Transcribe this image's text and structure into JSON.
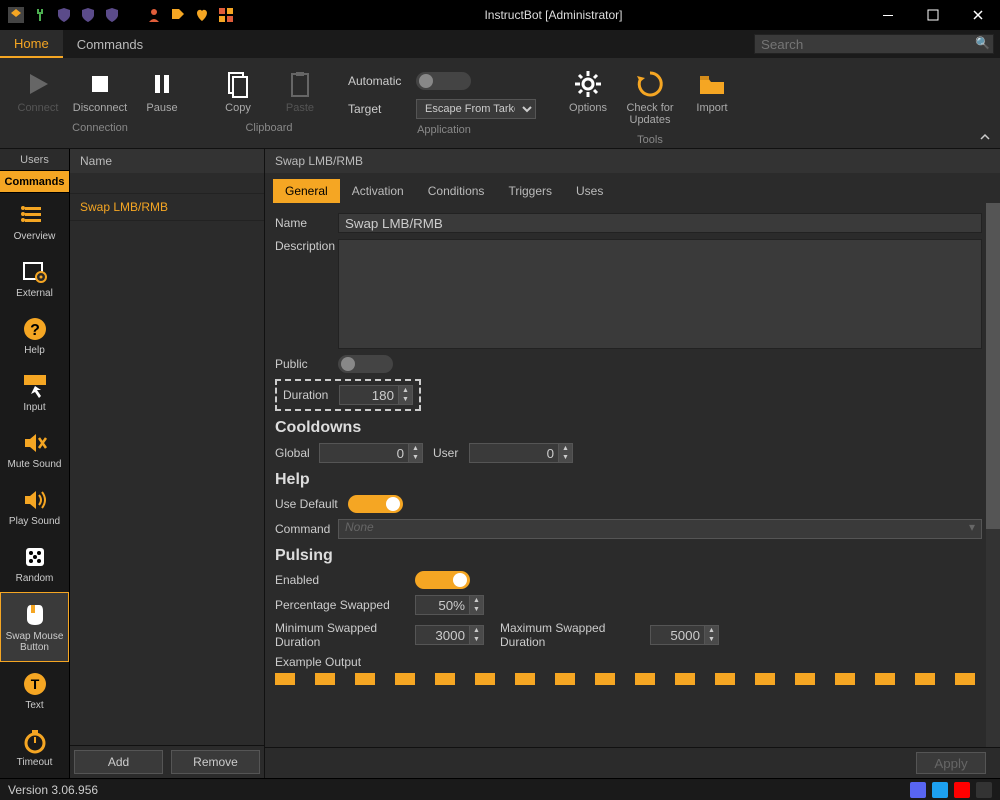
{
  "window": {
    "title": "InstructBot [Administrator]"
  },
  "tabs": {
    "home": "Home",
    "commands": "Commands"
  },
  "search": {
    "placeholder": "Search"
  },
  "ribbon": {
    "connect": "Connect",
    "disconnect": "Disconnect",
    "pause": "Pause",
    "copy": "Copy",
    "paste": "Paste",
    "automatic_label": "Automatic",
    "target_label": "Target",
    "target_value": "Escape From Tarkov",
    "options": "Options",
    "check_updates": "Check for\nUpdates",
    "import": "Import",
    "group_connection": "Connection",
    "group_clipboard": "Clipboard",
    "group_application": "Application",
    "group_tools": "Tools"
  },
  "left": {
    "users": "Users",
    "commands": "Commands",
    "overview": "Overview",
    "external": "External",
    "help": "Help",
    "input": "Input",
    "mute": "Mute Sound",
    "play": "Play Sound",
    "random": "Random",
    "swap": "Swap Mouse\nButton",
    "text": "Text",
    "timeout": "Timeout"
  },
  "mid": {
    "header": "Name",
    "item": "Swap LMB/RMB",
    "add": "Add",
    "remove": "Remove"
  },
  "detail": {
    "header": "Swap LMB/RMB",
    "tabs": {
      "general": "General",
      "activation": "Activation",
      "conditions": "Conditions",
      "triggers": "Triggers",
      "uses": "Uses"
    },
    "name_label": "Name",
    "name_value": "Swap LMB/RMB",
    "description_label": "Description",
    "description_value": "",
    "public_label": "Public",
    "duration_label": "Duration",
    "duration_value": "180",
    "cooldowns_h": "Cooldowns",
    "global_label": "Global",
    "global_value": "0",
    "user_label": "User",
    "user_value": "0",
    "help_h": "Help",
    "use_default_label": "Use Default",
    "command_label": "Command",
    "command_value": "None",
    "pulsing_h": "Pulsing",
    "enabled_label": "Enabled",
    "pct_label": "Percentage Swapped",
    "pct_value": "50%",
    "min_dur_label": "Minimum Swapped Duration",
    "min_dur_value": "3000",
    "max_dur_label": "Maximum Swapped Duration",
    "max_dur_value": "5000",
    "example_label": "Example Output",
    "apply": "Apply"
  },
  "status": {
    "version": "Version 3.06.956"
  }
}
